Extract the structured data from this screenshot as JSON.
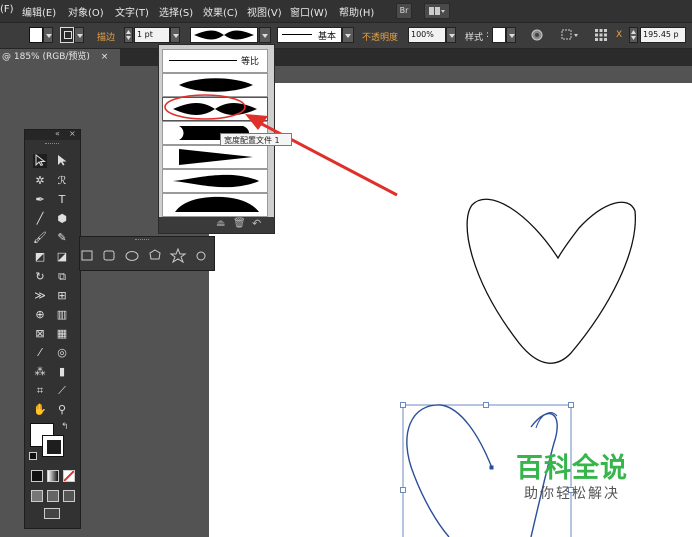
{
  "menu": {
    "items": [
      "(F)",
      "编辑(E)",
      "对象(O)",
      "文字(T)",
      "选择(S)",
      "效果(C)",
      "视图(V)",
      "窗口(W)",
      "帮助(H)"
    ],
    "bridge_label": "Br"
  },
  "control": {
    "stroke_label": "描边",
    "stroke_weight": "1 pt",
    "brush_label": "基本",
    "opacity_label": "不透明度",
    "opacity_value": "100%",
    "style_label": "样式",
    "x_label": "X",
    "x_value": "195.45 p"
  },
  "document": {
    "tab_label": "@ 185% (RGB/预览)",
    "close_glyph": "×"
  },
  "profiles": {
    "uniform_label": "等比",
    "tooltip": "宽度配置文件 1"
  },
  "watermark": {
    "title": "百科全说",
    "subtitle": "助你轻松解决"
  },
  "colors": {
    "accent_arrow": "#e0302a",
    "selection": "#4a6db5",
    "watermark_green": "#36b54a"
  },
  "icons": [
    "selection-tool-icon",
    "direct-selection-tool-icon",
    "magic-wand-icon",
    "lasso-icon",
    "pen-tool-icon",
    "type-tool-icon",
    "line-tool-icon",
    "ellipse-tool-icon",
    "paintbrush-icon",
    "pencil-icon",
    "blob-brush-icon",
    "eraser-icon",
    "rotate-icon",
    "scale-icon",
    "width-tool-icon",
    "free-transform-icon",
    "shape-builder-icon",
    "perspective-icon",
    "mesh-icon",
    "gradient-icon",
    "eyedropper-icon",
    "blend-icon",
    "symbol-sprayer-icon",
    "graph-icon",
    "artboard-icon",
    "slice-icon",
    "hand-icon",
    "zoom-icon"
  ]
}
